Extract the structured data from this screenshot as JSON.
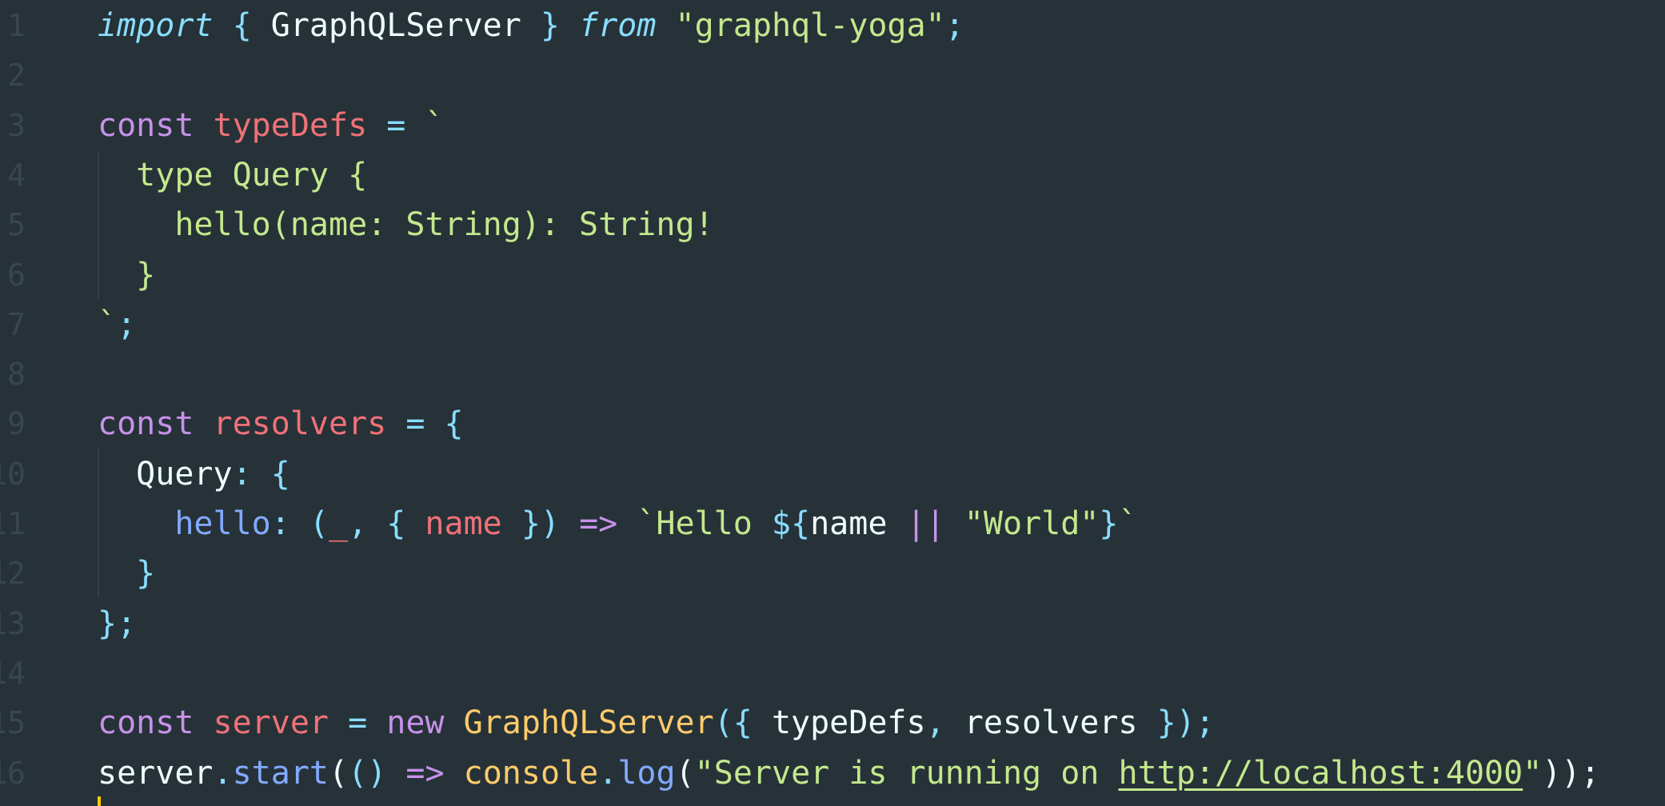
{
  "editor": {
    "theme_colors": {
      "background": "#263238",
      "keyword": "#C792EA",
      "variable": "#F07178",
      "operator": "#89DDFF",
      "string": "#C3E88D",
      "class": "#FFCB6B",
      "function": "#82AAFF",
      "plain": "#EEFFFF",
      "line_number": "#37474F",
      "cursor": "#FFCC00"
    },
    "line_numbers": [
      "1",
      "2",
      "3",
      "4",
      "5",
      "6",
      "7",
      "8",
      "9",
      "10",
      "11",
      "12",
      "13",
      "14",
      "15",
      "16"
    ],
    "lines": [
      {
        "tokens": [
          {
            "t": "import",
            "c": "imp"
          },
          {
            "t": " ",
            "c": "plain"
          },
          {
            "t": "{",
            "c": "op"
          },
          {
            "t": " GraphQLServer ",
            "c": "plain"
          },
          {
            "t": "}",
            "c": "op"
          },
          {
            "t": " ",
            "c": "plain"
          },
          {
            "t": "from",
            "c": "imp"
          },
          {
            "t": " ",
            "c": "plain"
          },
          {
            "t": "\"graphql-yoga\"",
            "c": "str"
          },
          {
            "t": ";",
            "c": "op"
          }
        ]
      },
      {
        "tokens": []
      },
      {
        "tokens": [
          {
            "t": "const",
            "c": "kw"
          },
          {
            "t": " ",
            "c": "plain"
          },
          {
            "t": "typeDefs",
            "c": "var"
          },
          {
            "t": " = ",
            "c": "op"
          },
          {
            "t": "`",
            "c": "str"
          }
        ]
      },
      {
        "tokens": [
          {
            "t": "  type Query {",
            "c": "str"
          }
        ]
      },
      {
        "tokens": [
          {
            "t": "    hello(name: String): String!",
            "c": "str"
          }
        ]
      },
      {
        "tokens": [
          {
            "t": "  }",
            "c": "str"
          }
        ]
      },
      {
        "tokens": [
          {
            "t": "`",
            "c": "str"
          },
          {
            "t": ";",
            "c": "op"
          }
        ]
      },
      {
        "tokens": []
      },
      {
        "tokens": [
          {
            "t": "const",
            "c": "kw"
          },
          {
            "t": " ",
            "c": "plain"
          },
          {
            "t": "resolvers",
            "c": "var"
          },
          {
            "t": " = ",
            "c": "op"
          },
          {
            "t": "{",
            "c": "op"
          }
        ]
      },
      {
        "tokens": [
          {
            "t": "  Query",
            "c": "plain"
          },
          {
            "t": ": {",
            "c": "op"
          }
        ]
      },
      {
        "tokens": [
          {
            "t": "    ",
            "c": "plain"
          },
          {
            "t": "hello",
            "c": "fn"
          },
          {
            "t": ": (",
            "c": "op"
          },
          {
            "t": "_",
            "c": "var"
          },
          {
            "t": ", { ",
            "c": "op"
          },
          {
            "t": "name",
            "c": "var"
          },
          {
            "t": " }) ",
            "c": "op"
          },
          {
            "t": "=>",
            "c": "kw"
          },
          {
            "t": " ",
            "c": "plain"
          },
          {
            "t": "`Hello ",
            "c": "str"
          },
          {
            "t": "${",
            "c": "op"
          },
          {
            "t": "name ",
            "c": "plain"
          },
          {
            "t": "||",
            "c": "kw"
          },
          {
            "t": " ",
            "c": "plain"
          },
          {
            "t": "\"World\"",
            "c": "str"
          },
          {
            "t": "}",
            "c": "op"
          },
          {
            "t": "`",
            "c": "str"
          }
        ]
      },
      {
        "tokens": [
          {
            "t": "  }",
            "c": "op"
          }
        ]
      },
      {
        "tokens": [
          {
            "t": "};",
            "c": "op"
          }
        ]
      },
      {
        "tokens": []
      },
      {
        "tokens": [
          {
            "t": "const",
            "c": "kw"
          },
          {
            "t": " ",
            "c": "plain"
          },
          {
            "t": "server",
            "c": "var"
          },
          {
            "t": " = ",
            "c": "op"
          },
          {
            "t": "new",
            "c": "kw"
          },
          {
            "t": " ",
            "c": "plain"
          },
          {
            "t": "GraphQLServer",
            "c": "cls"
          },
          {
            "t": "({ ",
            "c": "op"
          },
          {
            "t": "typeDefs",
            "c": "plain"
          },
          {
            "t": ", ",
            "c": "op"
          },
          {
            "t": "resolvers ",
            "c": "plain"
          },
          {
            "t": "});",
            "c": "op"
          }
        ]
      },
      {
        "tokens": [
          {
            "t": "server",
            "c": "plain"
          },
          {
            "t": ".",
            "c": "op"
          },
          {
            "t": "start",
            "c": "fn"
          },
          {
            "t": "(",
            "c": "plain"
          },
          {
            "t": "()",
            "c": "op"
          },
          {
            "t": " ",
            "c": "plain"
          },
          {
            "t": "=>",
            "c": "kw"
          },
          {
            "t": " ",
            "c": "plain"
          },
          {
            "t": "console",
            "c": "cls"
          },
          {
            "t": ".",
            "c": "op"
          },
          {
            "t": "log",
            "c": "fn"
          },
          {
            "t": "(",
            "c": "plain"
          },
          {
            "t": "\"Server is running on ",
            "c": "str"
          },
          {
            "t": "http://localhost:4000",
            "c": "url"
          },
          {
            "t": "\"",
            "c": "str"
          },
          {
            "t": "));",
            "c": "plain"
          }
        ]
      }
    ]
  }
}
